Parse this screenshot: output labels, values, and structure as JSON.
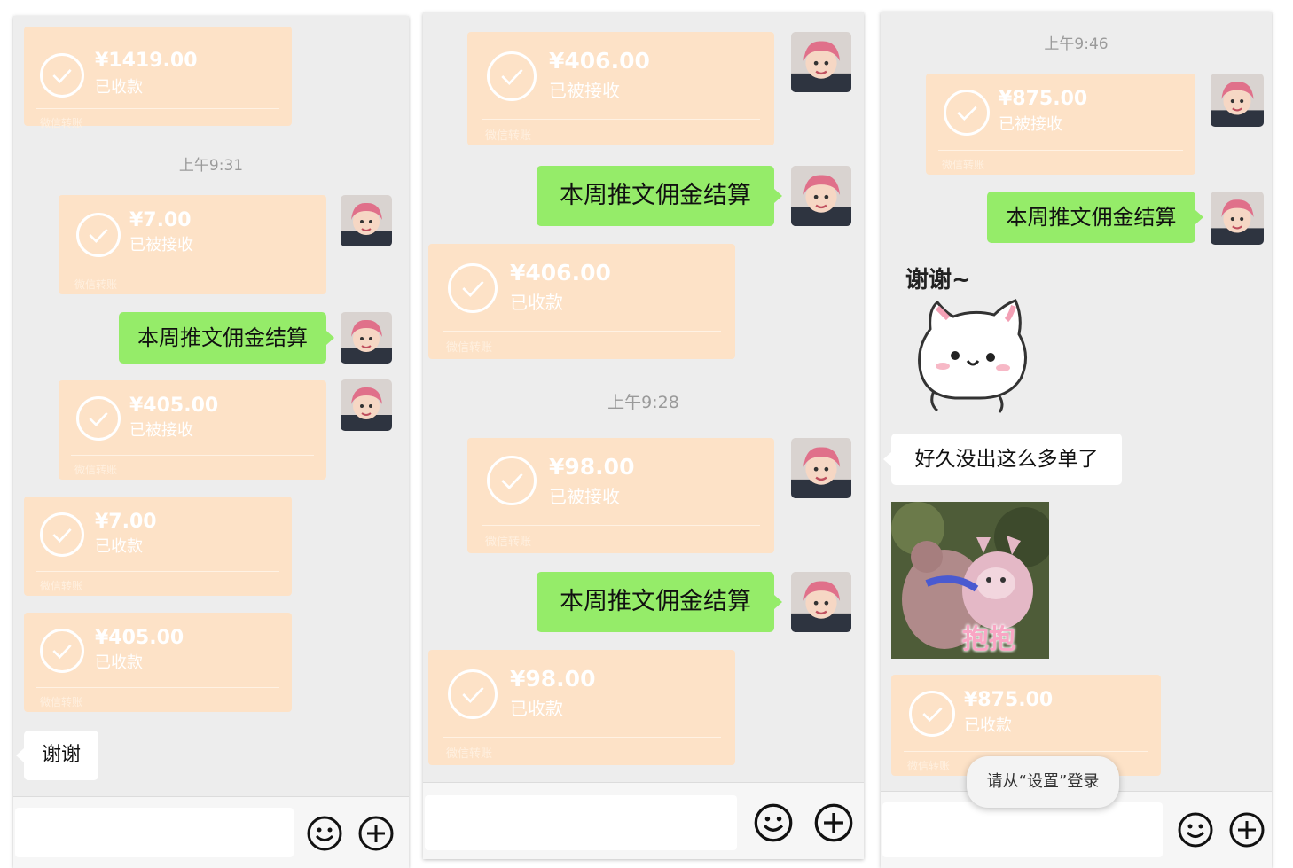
{
  "colors": {
    "chat_bg": "#ededed",
    "transfer_bg": "#fde2c7",
    "sent_bubble": "#95ec69",
    "received_bubble": "#ffffff"
  },
  "panel1": {
    "transfer_top": {
      "amount": "¥1419.00",
      "status": "已收款",
      "footer": "微信转账"
    },
    "timestamp": "上午9:31",
    "transfer_a": {
      "amount": "¥7.00",
      "status": "已被接收",
      "footer": "微信转账"
    },
    "sent_text": "本周推文佣金结算",
    "transfer_b": {
      "amount": "¥405.00",
      "status": "已被接收",
      "footer": "微信转账"
    },
    "transfer_c": {
      "amount": "¥7.00",
      "status": "已收款",
      "footer": "微信转账"
    },
    "transfer_d": {
      "amount": "¥405.00",
      "status": "已收款",
      "footer": "微信转账"
    },
    "received_text": "谢谢"
  },
  "panel2": {
    "transfer_a": {
      "amount": "¥406.00",
      "status": "已被接收",
      "footer": "微信转账"
    },
    "sent_text_1": "本周推文佣金结算",
    "transfer_b": {
      "amount": "¥406.00",
      "status": "已收款",
      "footer": "微信转账"
    },
    "timestamp": "上午9:28",
    "transfer_c": {
      "amount": "¥98.00",
      "status": "已被接收",
      "footer": "微信转账"
    },
    "sent_text_2": "本周推文佣金结算",
    "transfer_d": {
      "amount": "¥98.00",
      "status": "已收款",
      "footer": "微信转账"
    }
  },
  "panel3": {
    "timestamp": "上午9:46",
    "transfer_a": {
      "amount": "¥875.00",
      "status": "已被接收",
      "footer": "微信转账"
    },
    "sent_text": "本周推文佣金结算",
    "sticker_cat_text": "谢谢~",
    "received_text": "好久没出这么多单了",
    "sticker_hug_text": "抱抱",
    "transfer_b": {
      "amount": "¥875.00",
      "status": "已收款",
      "footer": "微信转账"
    },
    "toast": "请从“设置”登录"
  },
  "icons": {
    "emoji": "emoji-icon",
    "plus": "plus-icon",
    "check": "check-circle-icon",
    "avatar": "avatar-photo"
  }
}
